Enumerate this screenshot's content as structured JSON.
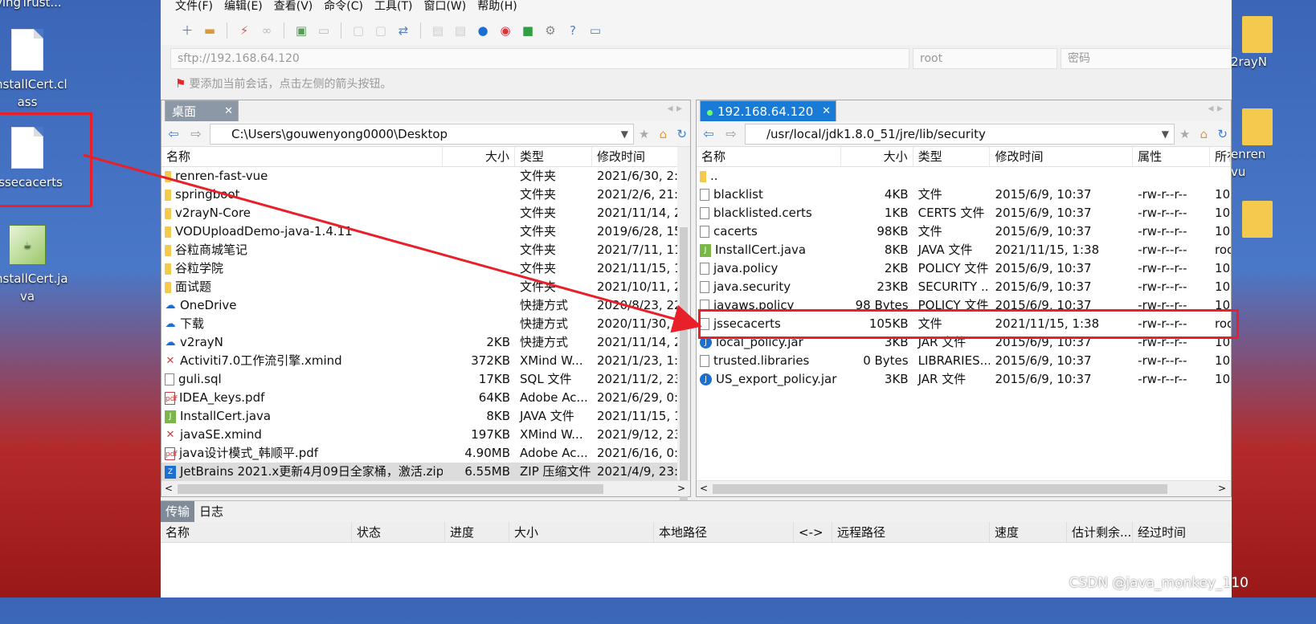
{
  "desktop": {
    "icons": [
      {
        "label": "vingTrust..."
      },
      {
        "label": "nstallCert.cl\nass"
      },
      {
        "label": "jssecacerts"
      },
      {
        "label": "nstallCert.ja\nva"
      }
    ],
    "right_icons": [
      {
        "label": "2rayN"
      },
      {
        "label": "enren\nvu"
      }
    ]
  },
  "menu": [
    "文件(F)",
    "编辑(E)",
    "查看(V)",
    "命令(C)",
    "工具(T)",
    "窗口(W)",
    "帮助(H)"
  ],
  "address": {
    "host": "sftp://192.168.64.120",
    "user": "root",
    "password": "密码"
  },
  "notice": "要添加当前会话，点击左侧的箭头按钮。",
  "left": {
    "tab": "桌面",
    "path": "C:\\Users\\gouwenyong0000\\Desktop",
    "columns": [
      "名称",
      "大小",
      "类型",
      "修改时间"
    ],
    "rows": [
      {
        "icon": "folder",
        "name": "renren-fast-vue",
        "size": "",
        "type": "文件夹",
        "mtime": "2021/6/30, 2:0"
      },
      {
        "icon": "folder",
        "name": "springboot",
        "size": "",
        "type": "文件夹",
        "mtime": "2021/2/6, 21:2"
      },
      {
        "icon": "folder",
        "name": "v2rayN-Core",
        "size": "",
        "type": "文件夹",
        "mtime": "2021/11/14, 2"
      },
      {
        "icon": "folder",
        "name": "VODUploadDemo-java-1.4.11",
        "size": "",
        "type": "文件夹",
        "mtime": "2019/6/28, 15"
      },
      {
        "icon": "folder",
        "name": "谷粒商城笔记",
        "size": "",
        "type": "文件夹",
        "mtime": "2021/7/11, 11"
      },
      {
        "icon": "folder",
        "name": "谷粒学院",
        "size": "",
        "type": "文件夹",
        "mtime": "2021/11/15, 1"
      },
      {
        "icon": "folder",
        "name": "面试题",
        "size": "",
        "type": "文件夹",
        "mtime": "2021/10/11, 2"
      },
      {
        "icon": "web",
        "name": "OneDrive",
        "size": "",
        "type": "快捷方式",
        "mtime": "2020/8/23, 22"
      },
      {
        "icon": "web",
        "name": "下载",
        "size": "",
        "type": "快捷方式",
        "mtime": "2020/11/30, 2"
      },
      {
        "icon": "web",
        "name": "v2rayN",
        "size": "2KB",
        "type": "快捷方式",
        "mtime": "2021/11/14, 2"
      },
      {
        "icon": "x",
        "name": "Activiti7.0工作流引擎.xmind",
        "size": "372KB",
        "type": "XMind W...",
        "mtime": "2021/1/23, 1:2"
      },
      {
        "icon": "doc",
        "name": "guli.sql",
        "size": "17KB",
        "type": "SQL 文件",
        "mtime": "2021/11/2, 23"
      },
      {
        "icon": "pdf",
        "name": "IDEA_keys.pdf",
        "size": "64KB",
        "type": "Adobe Ac...",
        "mtime": "2021/6/29, 0:3"
      },
      {
        "icon": "java",
        "name": "InstallCert.java",
        "size": "8KB",
        "type": "JAVA 文件",
        "mtime": "2021/11/15, 1"
      },
      {
        "icon": "x",
        "name": "javaSE.xmind",
        "size": "197KB",
        "type": "XMind W...",
        "mtime": "2021/9/12, 23"
      },
      {
        "icon": "pdf",
        "name": "java设计模式_韩顺平.pdf",
        "size": "4.90MB",
        "type": "Adobe Ac...",
        "mtime": "2021/6/16, 0:5"
      },
      {
        "icon": "zip",
        "name": "JetBrains 2021.x更新4月09日全家桶，激活.zip",
        "size": "6.55MB",
        "type": "ZIP 压缩文件",
        "mtime": "2021/4/9, 23:1"
      }
    ]
  },
  "right": {
    "tab": "192.168.64.120",
    "path": "/usr/local/jdk1.8.0_51/jre/lib/security",
    "columns": [
      "名称",
      "大小",
      "类型",
      "修改时间",
      "属性",
      "所有"
    ],
    "rows": [
      {
        "icon": "folder",
        "name": "..",
        "size": "",
        "type": "",
        "mtime": "",
        "attr": "",
        "owner": ""
      },
      {
        "icon": "doc",
        "name": "blacklist",
        "size": "4KB",
        "type": "文件",
        "mtime": "2015/6/9, 10:37",
        "attr": "-rw-r--r--",
        "owner": "10"
      },
      {
        "icon": "doc",
        "name": "blacklisted.certs",
        "size": "1KB",
        "type": "CERTS 文件",
        "mtime": "2015/6/9, 10:37",
        "attr": "-rw-r--r--",
        "owner": "10"
      },
      {
        "icon": "doc",
        "name": "cacerts",
        "size": "98KB",
        "type": "文件",
        "mtime": "2015/6/9, 10:37",
        "attr": "-rw-r--r--",
        "owner": "10"
      },
      {
        "icon": "java",
        "name": "InstallCert.java",
        "size": "8KB",
        "type": "JAVA 文件",
        "mtime": "2021/11/15, 1:38",
        "attr": "-rw-r--r--",
        "owner": "roo"
      },
      {
        "icon": "doc",
        "name": "java.policy",
        "size": "2KB",
        "type": "POLICY 文件",
        "mtime": "2015/6/9, 10:37",
        "attr": "-rw-r--r--",
        "owner": "10"
      },
      {
        "icon": "doc",
        "name": "java.security",
        "size": "23KB",
        "type": "SECURITY ...",
        "mtime": "2015/6/9, 10:37",
        "attr": "-rw-r--r--",
        "owner": "10"
      },
      {
        "icon": "doc",
        "name": "javaws.policy",
        "size": "98 Bytes",
        "type": "POLICY 文件",
        "mtime": "2015/6/9, 10:37",
        "attr": "-rw-r--r--",
        "owner": "10"
      },
      {
        "icon": "doc",
        "name": "jssecacerts",
        "size": "105KB",
        "type": "文件",
        "mtime": "2021/11/15, 1:38",
        "attr": "-rw-r--r--",
        "owner": "roo"
      },
      {
        "icon": "jar",
        "name": "local_policy.jar",
        "size": "3KB",
        "type": "JAR 文件",
        "mtime": "2015/6/9, 10:37",
        "attr": "-rw-r--r--",
        "owner": "10"
      },
      {
        "icon": "doc",
        "name": "trusted.libraries",
        "size": "0 Bytes",
        "type": "LIBRARIES...",
        "mtime": "2015/6/9, 10:37",
        "attr": "-rw-r--r--",
        "owner": "10"
      },
      {
        "icon": "jar",
        "name": "US_export_policy.jar",
        "size": "3KB",
        "type": "JAR 文件",
        "mtime": "2015/6/9, 10:37",
        "attr": "-rw-r--r--",
        "owner": "10"
      }
    ]
  },
  "transfer": {
    "tabs": [
      "传输",
      "日志"
    ],
    "columns": [
      "名称",
      "状态",
      "进度",
      "大小",
      "本地路径",
      "<->",
      "远程路径",
      "速度",
      "估计剩余...",
      "经过时间"
    ]
  },
  "watermark": "CSDN @java_monkey_110"
}
